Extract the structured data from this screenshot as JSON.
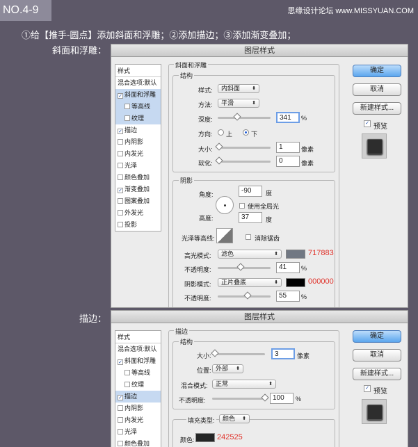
{
  "badge": "NO.4-9",
  "watermark": "思缘设计论坛 www.MISSYUAN.COM",
  "instruction": "①给【推手-圆点】添加斜面和浮雕；②添加描边；③添加渐变叠加；",
  "sections": {
    "bevel_label": "斜面和浮雕：",
    "stroke_label": "描边："
  },
  "dialog1": {
    "title": "图层样式",
    "list": {
      "header": "样式",
      "rows": [
        "混合选项:默认",
        "斜面和浮雕",
        "等高线",
        "纹理",
        "描边",
        "内阴影",
        "内发光",
        "光泽",
        "颜色叠加",
        "渐变叠加",
        "图案叠加",
        "外发光",
        "投影"
      ]
    },
    "bevel": {
      "panel_title": "斜面和浮雕",
      "structure_title": "结构",
      "style_label": "样式:",
      "style_value": "内斜面",
      "method_label": "方法:",
      "method_value": "平滑",
      "depth_label": "深度:",
      "depth_value": "341",
      "depth_unit": "%",
      "direction_label": "方向:",
      "dir_up": "上",
      "dir_down": "下",
      "size_label": "大小:",
      "size_value": "1",
      "size_unit": "像素",
      "soften_label": "软化:",
      "soften_value": "0",
      "soften_unit": "像素"
    },
    "shading": {
      "title": "阴影",
      "angle_label": "角度:",
      "angle_value": "-90",
      "angle_unit": "度",
      "global_light": "使用全局光",
      "altitude_label": "高度:",
      "altitude_value": "37",
      "altitude_unit": "度",
      "gloss_label": "光泽等高线:",
      "antialias": "消除锯齿",
      "highlight_label": "高光模式:",
      "highlight_mode": "滤色",
      "highlight_hex": "717883",
      "highlight_color": "#717883",
      "h_opacity_label": "不透明度:",
      "h_opacity_value": "41",
      "h_opacity_unit": "%",
      "shadow_label": "阴影模式:",
      "shadow_mode": "正片叠底",
      "shadow_hex": "000000",
      "shadow_color": "#000000",
      "s_opacity_label": "不透明度:",
      "s_opacity_value": "55",
      "s_opacity_unit": "%"
    },
    "buttons": {
      "ok": "确定",
      "cancel": "取消",
      "new_style": "新建样式...",
      "preview": "预览"
    }
  },
  "dialog2": {
    "title": "图层样式",
    "list": {
      "header": "样式",
      "rows": [
        "混合选项:默认",
        "斜面和浮雕",
        "等高线",
        "纹理",
        "描边",
        "内阴影",
        "内发光",
        "光泽",
        "颜色叠加"
      ]
    },
    "stroke": {
      "panel_title": "描边",
      "structure_title": "结构",
      "size_label": "大小:",
      "size_value": "3",
      "size_unit": "像素",
      "position_label": "位置:",
      "position_value": "外部",
      "blend_label": "混合模式:",
      "blend_value": "正常",
      "opacity_label": "不透明度:",
      "opacity_value": "100",
      "opacity_unit": "%",
      "fill_type_label": "填充类型:",
      "fill_type_value": "颜色",
      "color_label": "颜色:",
      "color_hex": "242525",
      "color": "#242525"
    },
    "buttons": {
      "ok": "确定",
      "cancel": "取消",
      "new_style": "新建样式...",
      "preview": "预览"
    }
  }
}
